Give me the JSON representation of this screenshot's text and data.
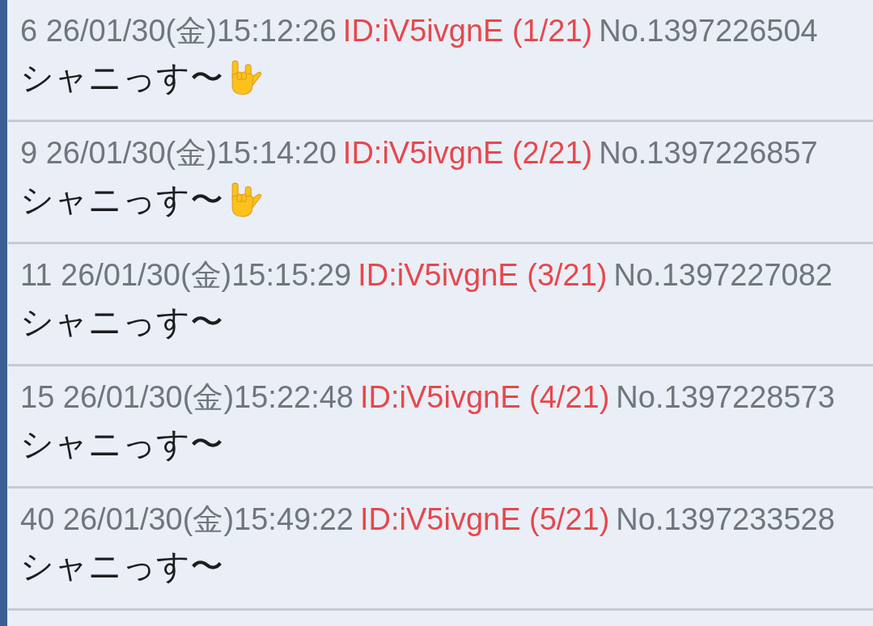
{
  "posts": [
    {
      "meta": "6 26/01/30(金)15:12:26",
      "id": "ID:iV5ivgnE (1/21)",
      "no": "No.1397226504",
      "body": "シャニっす〜",
      "emoji": true
    },
    {
      "meta": "9 26/01/30(金)15:14:20",
      "id": "ID:iV5ivgnE (2/21)",
      "no": "No.1397226857",
      "body": "シャニっす〜",
      "emoji": true
    },
    {
      "meta": "11 26/01/30(金)15:15:29",
      "id": "ID:iV5ivgnE (3/21)",
      "no": "No.1397227082",
      "body": "シャニっす〜",
      "emoji": false
    },
    {
      "meta": "15 26/01/30(金)15:22:48",
      "id": "ID:iV5ivgnE (4/21)",
      "no": "No.1397228573",
      "body": "シャニっす〜",
      "emoji": false
    },
    {
      "meta": "40 26/01/30(金)15:49:22",
      "id": "ID:iV5ivgnE (5/21)",
      "no": "No.1397233528",
      "body": "シャニっす〜",
      "emoji": false
    }
  ]
}
